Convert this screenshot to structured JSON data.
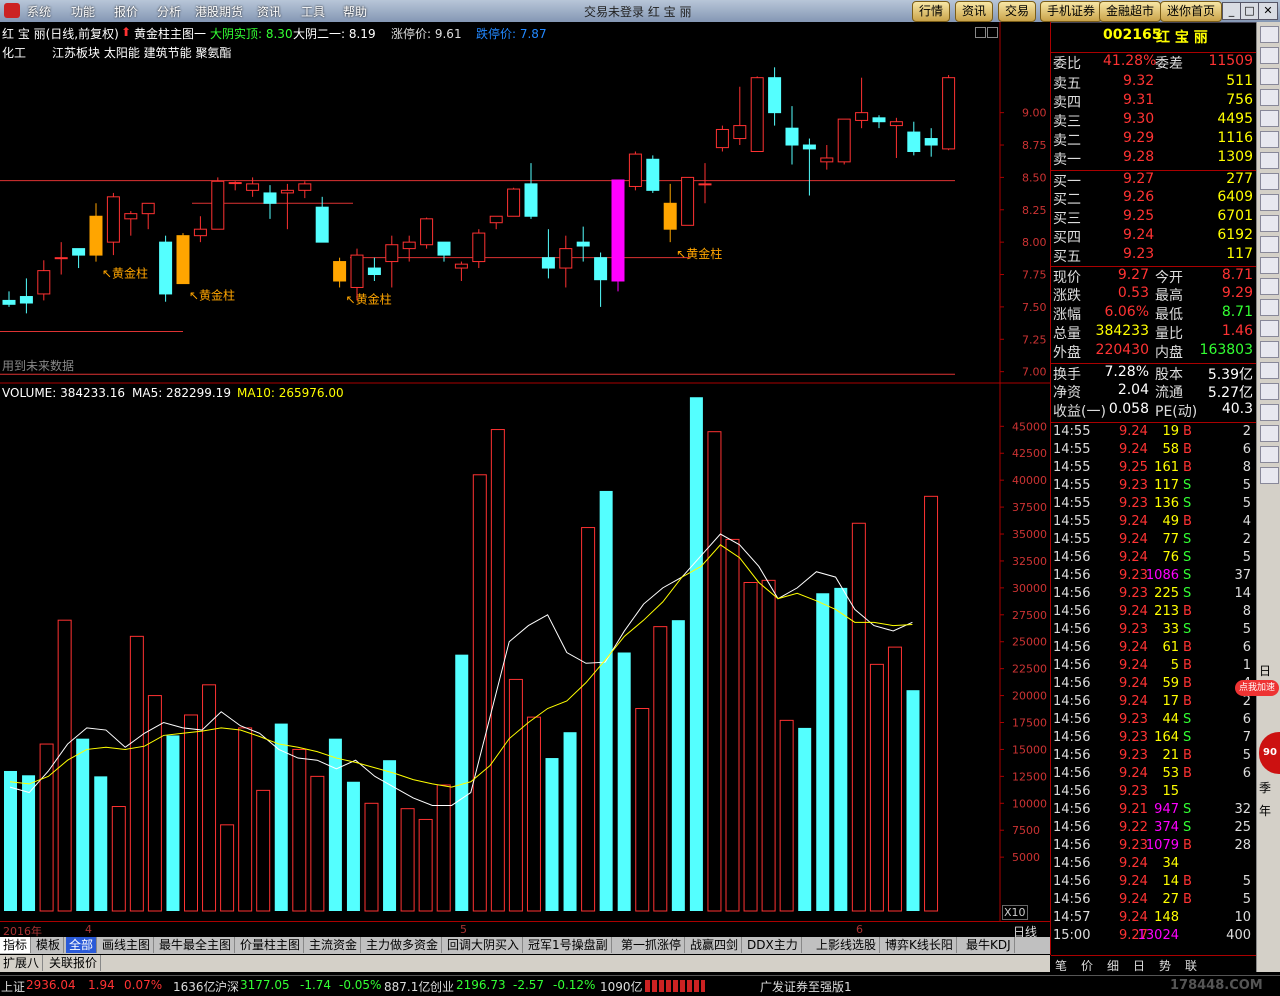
{
  "window": {
    "title": "交易未登录  红 宝 丽",
    "menu": [
      "系统",
      "功能",
      "报价",
      "分析",
      "港股期货",
      "资讯",
      "工具",
      "帮助"
    ],
    "top_buttons": [
      "行情",
      "资讯",
      "交易",
      "手机证券",
      "金融超市",
      "迷你首页"
    ]
  },
  "chart_header": {
    "title": "红 宝 丽(日线,前复权)",
    "indicator": "黄金柱主图一",
    "item1": "大阴实顶: 8.30",
    "item2": "大阴二一: 8.19",
    "item3": "涨停价: 9.61",
    "item4": "跌停价: 7.87",
    "sector_label": "化工",
    "sectors": "江苏板块 太阳能 建筑节能 聚氨酯",
    "future_note": "用到未来数据",
    "golden_label": "黄金柱"
  },
  "price_axis": [
    "9.00",
    "8.75",
    "8.50",
    "8.25",
    "8.00",
    "7.75",
    "7.50",
    "7.25",
    "7.00"
  ],
  "volume_header": {
    "volume": "VOLUME: 384233.16",
    "ma5": "MA5: 282299.19",
    "ma10": "MA10: 265976.00"
  },
  "volume_axis": [
    "45000",
    "42500",
    "40000",
    "37500",
    "35000",
    "32500",
    "30000",
    "27500",
    "25000",
    "22500",
    "20000",
    "17500",
    "15000",
    "12500",
    "10000",
    "7500",
    "5000"
  ],
  "volume_unit": "X10",
  "time_axis": [
    "2016年",
    "4",
    "5",
    "6"
  ],
  "period": "日线",
  "colors": {
    "up": "#ff3232",
    "down": "#54ffff",
    "gold": "#ffa500",
    "magenta": "#ff00ff",
    "ma5": "#ffffff",
    "ma10": "#ffff00"
  },
  "chart_data": {
    "type": "candlestick",
    "ylim": [
      6.92,
      9.7
    ],
    "candles": [
      [
        7.55,
        7.62,
        7.5,
        7.52
      ],
      [
        7.58,
        7.72,
        7.45,
        7.53
      ],
      [
        7.6,
        7.86,
        7.55,
        7.78
      ],
      [
        7.88,
        8.0,
        7.75,
        7.88
      ],
      [
        7.95,
        7.95,
        7.8,
        7.9
      ],
      [
        8.2,
        8.3,
        7.85,
        7.9
      ],
      [
        8.0,
        8.38,
        7.9,
        8.35
      ],
      [
        8.18,
        8.24,
        8.05,
        8.22
      ],
      [
        8.22,
        8.3,
        8.1,
        8.3
      ],
      [
        8.0,
        8.05,
        7.54,
        7.6
      ],
      [
        7.68,
        8.07,
        7.68,
        8.05
      ],
      [
        8.05,
        8.2,
        8.0,
        8.1
      ],
      [
        8.1,
        8.5,
        8.1,
        8.47
      ],
      [
        8.46,
        8.47,
        8.4,
        8.46
      ],
      [
        8.4,
        8.5,
        8.35,
        8.45
      ],
      [
        8.38,
        8.44,
        8.18,
        8.3
      ],
      [
        8.38,
        8.45,
        8.1,
        8.4
      ],
      [
        8.4,
        8.47,
        8.34,
        8.45
      ],
      [
        8.27,
        8.35,
        8.1,
        8.0
      ],
      [
        7.85,
        7.88,
        7.65,
        7.7
      ],
      [
        7.65,
        7.95,
        7.55,
        7.9
      ],
      [
        7.8,
        7.88,
        7.7,
        7.75
      ],
      [
        7.85,
        8.05,
        7.65,
        7.98
      ],
      [
        7.95,
        8.05,
        7.85,
        8.0
      ],
      [
        7.98,
        8.19,
        7.95,
        8.18
      ],
      [
        8.0,
        8.0,
        7.85,
        7.9
      ],
      [
        7.8,
        7.85,
        7.7,
        7.83
      ],
      [
        7.85,
        8.1,
        7.8,
        8.07
      ],
      [
        8.15,
        8.2,
        8.1,
        8.2
      ],
      [
        8.2,
        8.42,
        8.2,
        8.41
      ],
      [
        8.45,
        8.61,
        8.18,
        8.2
      ],
      [
        7.88,
        8.1,
        7.72,
        7.8
      ],
      [
        7.8,
        8.05,
        7.65,
        7.95
      ],
      [
        8.0,
        8.12,
        7.85,
        7.97
      ],
      [
        7.88,
        7.92,
        7.5,
        7.71
      ],
      [
        7.7,
        8.48,
        7.62,
        8.48
      ],
      [
        8.43,
        8.7,
        8.4,
        8.68
      ],
      [
        8.64,
        8.67,
        8.38,
        8.4
      ],
      [
        8.3,
        8.45,
        8.0,
        8.1
      ],
      [
        8.13,
        8.5,
        8.13,
        8.5
      ],
      [
        8.45,
        8.61,
        8.3,
        8.45
      ],
      [
        8.73,
        8.9,
        8.7,
        8.87
      ],
      [
        8.8,
        9.2,
        8.75,
        8.9
      ],
      [
        8.7,
        9.28,
        8.7,
        9.27
      ],
      [
        9.27,
        9.35,
        8.9,
        9.0
      ],
      [
        8.88,
        9.05,
        8.6,
        8.75
      ],
      [
        8.75,
        8.8,
        8.36,
        8.72
      ],
      [
        8.62,
        8.75,
        8.56,
        8.65
      ],
      [
        8.62,
        8.94,
        8.6,
        8.95
      ],
      [
        8.94,
        9.27,
        8.88,
        9.0
      ],
      [
        8.96,
        8.98,
        8.88,
        8.93
      ],
      [
        8.9,
        8.96,
        8.65,
        8.93
      ],
      [
        8.85,
        8.93,
        8.67,
        8.7
      ],
      [
        8.8,
        8.88,
        8.66,
        8.75
      ],
      [
        8.72,
        9.29,
        8.71,
        9.27
      ]
    ],
    "golden_bars": [
      5,
      10,
      19,
      38
    ],
    "magenta_bar": 35,
    "volume_ylim": [
      0,
      48000
    ],
    "volumes": [
      13000,
      12600,
      15500,
      27000,
      16000,
      12500,
      9700,
      25500,
      20000,
      16300,
      18200,
      21000,
      8000,
      17000,
      11200,
      17400,
      15000,
      12500,
      16000,
      12000,
      10000,
      14000,
      9500,
      8500,
      11700,
      23800,
      40500,
      44700,
      21500,
      18000,
      14200,
      16600,
      35600,
      39000,
      24000,
      18800,
      26400,
      27000,
      47700,
      44500,
      34500,
      30500,
      30700,
      17700,
      17000,
      29500,
      30000,
      36000,
      22900,
      24500,
      20500,
      38500
    ],
    "ma5": [
      11500,
      11000,
      13000,
      15500,
      17000,
      16800,
      15200,
      16500,
      17500,
      17000,
      16800,
      18500,
      17200,
      16500,
      15000,
      14200,
      14000,
      13200,
      14000,
      12500,
      11500,
      10500,
      9800,
      9800,
      11000,
      18000,
      25000,
      26500,
      27500,
      24000,
      23000,
      23100,
      26000,
      28500,
      30000,
      31000,
      33000,
      35000,
      34000,
      32000,
      29000,
      30000,
      31500,
      31000,
      28000,
      26500,
      26000,
      26800
    ],
    "ma10": [
      12000,
      11800,
      12500,
      14000,
      15000,
      15200,
      15000,
      15300,
      16300,
      16500,
      16700,
      17000,
      16800,
      16200,
      15500,
      15200,
      14800,
      14200,
      13800,
      13300,
      12800,
      12200,
      11800,
      11500,
      12000,
      13500,
      16000,
      17500,
      18800,
      19500,
      21200,
      23300,
      25500,
      27000,
      28700,
      31000,
      32000,
      34000,
      32800,
      30500,
      29000,
      29500,
      28800,
      28000,
      26800,
      26800,
      26500,
      26600
    ]
  },
  "quote": {
    "code": "002165",
    "name": "红 宝 丽",
    "webi_label": "委比",
    "webi": "41.28%",
    "weicha_label": "委差",
    "weicha": "11509",
    "sells": [
      [
        "卖五",
        "9.32",
        "511"
      ],
      [
        "卖四",
        "9.31",
        "756"
      ],
      [
        "卖三",
        "9.30",
        "4495"
      ],
      [
        "卖二",
        "9.29",
        "1116"
      ],
      [
        "卖一",
        "9.28",
        "1309"
      ]
    ],
    "buys": [
      [
        "买一",
        "9.27",
        "277"
      ],
      [
        "买二",
        "9.26",
        "6409"
      ],
      [
        "买三",
        "9.25",
        "6701"
      ],
      [
        "买四",
        "9.24",
        "6192"
      ],
      [
        "买五",
        "9.23",
        "117"
      ]
    ],
    "stats": [
      [
        "现价",
        "9.27",
        "今开",
        "8.71"
      ],
      [
        "涨跌",
        "0.53",
        "最高",
        "9.29"
      ],
      [
        "涨幅",
        "6.06%",
        "最低",
        "8.71"
      ],
      [
        "总量",
        "384233",
        "量比",
        "1.46"
      ],
      [
        "外盘",
        "220430",
        "内盘",
        "163803"
      ],
      [
        "换手",
        "7.28%",
        "股本",
        "5.39亿"
      ],
      [
        "净资",
        "2.04",
        "流通",
        "5.27亿"
      ],
      [
        "收益(一)",
        "0.058",
        "PE(动)",
        "40.3"
      ]
    ],
    "ticks": [
      [
        "14:55",
        "9.24",
        "19",
        "B",
        "2"
      ],
      [
        "14:55",
        "9.24",
        "58",
        "B",
        "6"
      ],
      [
        "14:55",
        "9.25",
        "161",
        "B",
        "8"
      ],
      [
        "14:55",
        "9.23",
        "117",
        "S",
        "5"
      ],
      [
        "14:55",
        "9.23",
        "136",
        "S",
        "5"
      ],
      [
        "14:55",
        "9.24",
        "49",
        "B",
        "4"
      ],
      [
        "14:55",
        "9.24",
        "77",
        "S",
        "2"
      ],
      [
        "14:56",
        "9.24",
        "76",
        "S",
        "5"
      ],
      [
        "14:56",
        "9.23",
        "1086",
        "S",
        "37"
      ],
      [
        "14:56",
        "9.23",
        "225",
        "S",
        "14"
      ],
      [
        "14:56",
        "9.24",
        "213",
        "B",
        "8"
      ],
      [
        "14:56",
        "9.23",
        "33",
        "S",
        "5"
      ],
      [
        "14:56",
        "9.24",
        "61",
        "B",
        "6"
      ],
      [
        "14:56",
        "9.24",
        "5",
        "B",
        "1"
      ],
      [
        "14:56",
        "9.24",
        "59",
        "B",
        "4"
      ],
      [
        "14:56",
        "9.24",
        "17",
        "B",
        "2"
      ],
      [
        "14:56",
        "9.23",
        "44",
        "S",
        "6"
      ],
      [
        "14:56",
        "9.23",
        "164",
        "S",
        "7"
      ],
      [
        "14:56",
        "9.23",
        "21",
        "B",
        "5"
      ],
      [
        "14:56",
        "9.24",
        "53",
        "B",
        "6"
      ],
      [
        "14:56",
        "9.23",
        "15",
        "",
        ""
      ],
      [
        "14:56",
        "9.21",
        "947",
        "S",
        "32"
      ],
      [
        "14:56",
        "9.22",
        "374",
        "S",
        "25"
      ],
      [
        "14:56",
        "9.23",
        "1079",
        "B",
        "28"
      ],
      [
        "14:56",
        "9.24",
        "34",
        "",
        ""
      ],
      [
        "14:56",
        "9.24",
        "14",
        "B",
        "5"
      ],
      [
        "14:56",
        "9.24",
        "27",
        "B",
        "5"
      ],
      [
        "14:57",
        "9.24",
        "148",
        "",
        "10"
      ],
      [
        "15:00",
        "9.27",
        "13024",
        "",
        "400"
      ]
    ]
  },
  "bottom_tabs": [
    "指标",
    "模板",
    "全部",
    "画线主图",
    "最牛最全主图",
    "价量柱主图",
    "主流资金",
    "主力做多资金",
    "回调大阴买入",
    "冠军1号操盘副",
    "第一抓涨停",
    "战赢四剑",
    "DDX主力",
    "上影线选股",
    "博弈K线长阳",
    "最牛KDJ"
  ],
  "bottom_tabs2": [
    "扩展八",
    "关联报价"
  ],
  "right_tabs": [
    "笔",
    "价",
    "细",
    "日",
    "势",
    "联"
  ],
  "status": {
    "sh_label": "上证",
    "sh": "2936.04",
    "sh_chg": "1.94",
    "sh_pct": "0.07%",
    "sh_amt": "1636亿",
    "hs_label": "沪深",
    "hs": "3177.05",
    "hs_chg": "-1.74",
    "hs_pct": "-0.05%",
    "hs_amt": "887.1亿",
    "cy_label": "创业",
    "cy": "2196.73",
    "cy_chg": "-2.57",
    "cy_pct": "-0.12%",
    "cy_amt": "1090亿",
    "broker": "广发证券至强版1"
  },
  "side_labels": [
    "日",
    "季",
    "年"
  ],
  "promo": {
    "text": "点我加速",
    "num": "90"
  },
  "watermark": "178448.COM"
}
